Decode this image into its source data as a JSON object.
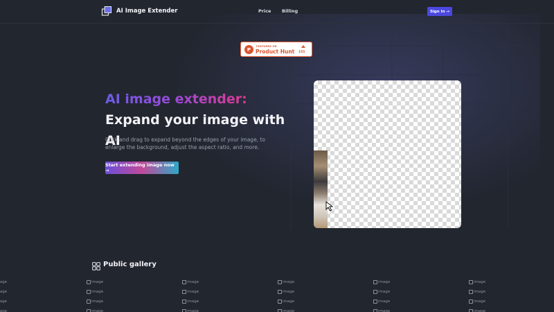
{
  "header": {
    "brand_name": "AI Image Extender",
    "nav": {
      "price": "Price",
      "billing": "Billing"
    },
    "signin_label": "Sign In →"
  },
  "product_hunt": {
    "featured_on": "FEATURED ON",
    "name": "Product Hunt",
    "upvotes": "155",
    "logo_letter": "P"
  },
  "hero": {
    "title_accent": "AI image extender:",
    "title_rest": " Expand your image with AI",
    "description": "Click and drag to expand beyond the edges of your image, to enlarge the background, adjust the aspect ratio, and more.",
    "cta_label": "Start extending image now →"
  },
  "gallery": {
    "title": "Public gallery",
    "image_alt": "image",
    "columns": 6,
    "rows_visible": 4
  },
  "colors": {
    "background": "#22262f",
    "accent": "#4b49e0",
    "product_hunt": "#da552f"
  }
}
